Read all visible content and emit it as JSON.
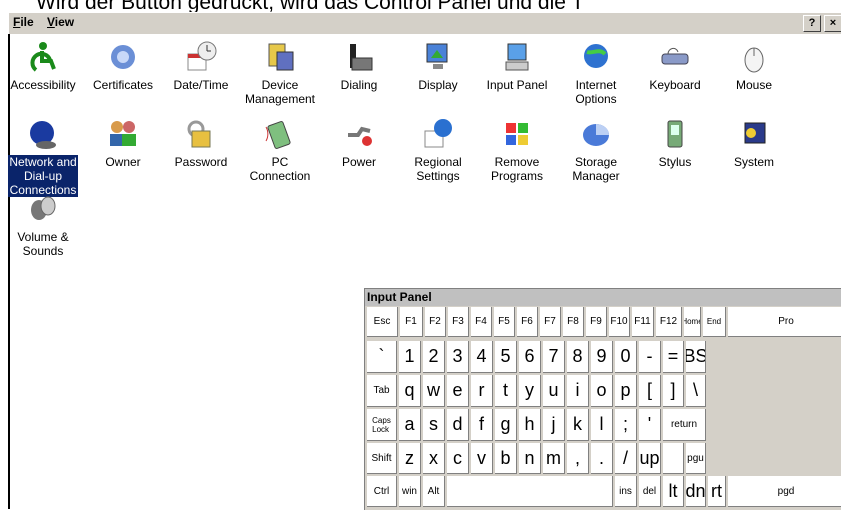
{
  "caption": "Wird der Button gedrückt, wird das Control Panel und die T",
  "menubar": {
    "file": "File",
    "view": "View",
    "help": "?",
    "close": "×"
  },
  "icons": [
    {
      "label": "Accessibility",
      "icon": "accessibility-icon"
    },
    {
      "label": "Certificates",
      "icon": "certificates-icon"
    },
    {
      "label": "Date/Time",
      "icon": "datetime-icon"
    },
    {
      "label": "Device\nManagement",
      "icon": "device-management-icon"
    },
    {
      "label": "Dialing",
      "icon": "dialing-icon"
    },
    {
      "label": "Display",
      "icon": "display-icon"
    },
    {
      "label": "Input Panel",
      "icon": "input-panel-icon"
    },
    {
      "label": "Internet\nOptions",
      "icon": "internet-options-icon"
    },
    {
      "label": "Keyboard",
      "icon": "keyboard-icon"
    },
    {
      "label": "Mouse",
      "icon": "mouse-icon"
    },
    {
      "label": "Network and\nDial-up\nConnections",
      "icon": "network-icon",
      "selected": true
    },
    {
      "label": "Owner",
      "icon": "owner-icon"
    },
    {
      "label": "Password",
      "icon": "password-icon"
    },
    {
      "label": "PC\nConnection",
      "icon": "pc-connection-icon"
    },
    {
      "label": "Power",
      "icon": "power-icon"
    },
    {
      "label": "Regional\nSettings",
      "icon": "regional-settings-icon"
    },
    {
      "label": "Remove\nPrograms",
      "icon": "remove-programs-icon"
    },
    {
      "label": "Storage\nManager",
      "icon": "storage-manager-icon"
    },
    {
      "label": "Stylus",
      "icon": "stylus-icon"
    },
    {
      "label": "System",
      "icon": "system-icon"
    },
    {
      "label": "Volume &\nSounds",
      "icon": "volume-icon"
    }
  ],
  "input_panel": {
    "title": "Input Panel",
    "rows": [
      [
        "Esc",
        "F1",
        "F2",
        "F3",
        "F4",
        "F5",
        "F6",
        "F7",
        "F8",
        "F9",
        "F10",
        "F11",
        "F12",
        "Home",
        "End",
        "Pro"
      ],
      [
        "`",
        "1",
        "2",
        "3",
        "4",
        "5",
        "6",
        "7",
        "8",
        "9",
        "0",
        "-",
        "=",
        "BS"
      ],
      [
        "Tab",
        "q",
        "w",
        "e",
        "r",
        "t",
        "y",
        "u",
        "i",
        "o",
        "p",
        "[",
        "]",
        "\\"
      ],
      [
        "Caps\nLock",
        "a",
        "s",
        "d",
        "f",
        "g",
        "h",
        "j",
        "k",
        "l",
        ";",
        "'",
        "return"
      ],
      [
        "Shift",
        "z",
        "x",
        "c",
        "v",
        "b",
        "n",
        "m",
        ",",
        ".",
        "/",
        "up",
        "",
        "pgu"
      ],
      [
        "Ctrl",
        "win",
        "Alt",
        "",
        "ins",
        "del",
        "lt",
        "dn",
        "rt",
        "pgd"
      ]
    ]
  }
}
